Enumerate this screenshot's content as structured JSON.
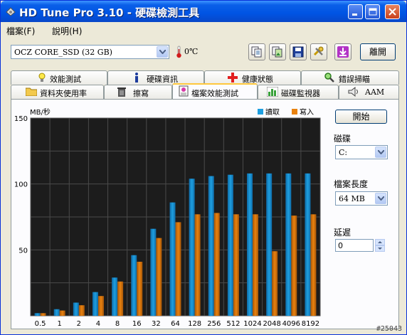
{
  "window": {
    "title": "HD Tune Pro 3.10 - 硬碟檢測工具"
  },
  "menu": {
    "items": [
      {
        "label": "檔案(F)"
      },
      {
        "label": "說明(H)"
      }
    ]
  },
  "toolbar": {
    "drive_select": "OCZ CORE_SSD (32 GB)",
    "temperature": "0℃",
    "exit_label": "離開"
  },
  "tabs": {
    "row1": [
      {
        "label": "效能測試"
      },
      {
        "label": "硬碟資訊"
      },
      {
        "label": "健康狀態"
      },
      {
        "label": "錯誤掃瞄"
      }
    ],
    "row2": [
      {
        "label": "資料夾使用率"
      },
      {
        "label": "擦寫"
      },
      {
        "label": "檔案效能測試"
      },
      {
        "label": "磁碟監視器"
      },
      {
        "label": "AAM"
      }
    ]
  },
  "side": {
    "start_label": "開始",
    "disk_label": "磁碟",
    "disk_value": "C:",
    "file_length_label": "檔案長度",
    "file_length_value": "64 MB",
    "delay_label": "延遲",
    "delay_value": "0"
  },
  "chart_data": {
    "type": "bar",
    "ylabel": "MB/秒",
    "ylim": [
      0,
      150
    ],
    "yticks": [
      "150",
      "100",
      "50"
    ],
    "categories": [
      "0.5",
      "1",
      "2",
      "4",
      "8",
      "16",
      "32",
      "64",
      "128",
      "256",
      "512",
      "1024",
      "2048",
      "4096",
      "8192"
    ],
    "series": [
      {
        "name": "讀取",
        "color": "#1E9FE0",
        "values": [
          2,
          5,
          10,
          18,
          29,
          46,
          66,
          86,
          104,
          106,
          107,
          108,
          108,
          108,
          108
        ]
      },
      {
        "name": "寫入",
        "color": "#E9820F",
        "values": [
          2,
          4,
          8,
          15,
          26,
          41,
          59,
          71,
          77,
          78,
          77,
          77,
          49,
          76,
          77
        ]
      }
    ],
    "grid": true
  },
  "watermark": "#25043",
  "colors": {
    "titlebar": "#0054E3",
    "read": "#1E9FE0",
    "write": "#E9820F",
    "plot_bg": "#1C1C1C"
  }
}
